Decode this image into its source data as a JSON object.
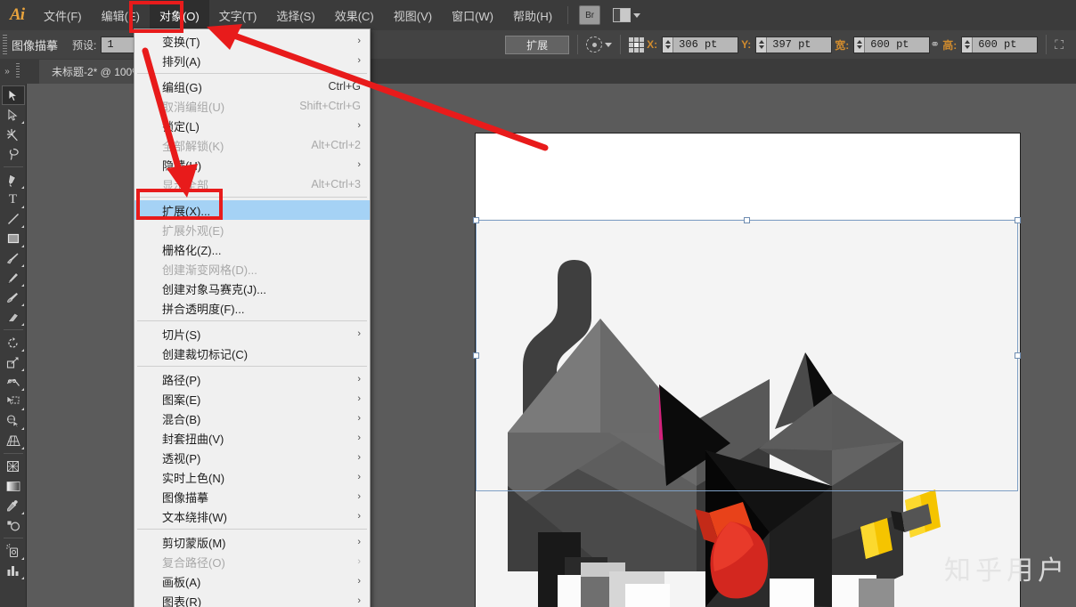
{
  "app": {
    "logo": "Ai",
    "title": "Adobe Illustrator"
  },
  "menubar": {
    "items": [
      {
        "label": "文件(F)",
        "active": false
      },
      {
        "label": "编辑(E)",
        "active": false
      },
      {
        "label": "对象(O)",
        "active": true
      },
      {
        "label": "文字(T)",
        "active": false
      },
      {
        "label": "选择(S)",
        "active": false
      },
      {
        "label": "效果(C)",
        "active": false
      },
      {
        "label": "视图(V)",
        "active": false
      },
      {
        "label": "窗口(W)",
        "active": false
      },
      {
        "label": "帮助(H)",
        "active": false
      }
    ],
    "bridge_button": "Br",
    "workspace_icon": "workspace-switcher-icon"
  },
  "controlbar": {
    "tool_label": "图像描摹",
    "preset_label": "预设:",
    "preset_value": "1",
    "expand_button": "扩展",
    "select_similar_icon": "select-similar-icon",
    "reference_point_icon": "reference-point-icon",
    "x_label": "X:",
    "x_value": "306 pt",
    "y_label": "Y:",
    "y_value": "397 pt",
    "w_label": "宽:",
    "w_value": "600 pt",
    "link_icon": "constrain-proportions-icon",
    "h_label": "高:",
    "h_value": "600 pt",
    "transform_icon": "transform-panel-icon"
  },
  "tabbar": {
    "document_tab": "未标题-2* @ 100%"
  },
  "toolbox": {
    "tools": [
      {
        "name": "selection-tool",
        "glyph": "selection",
        "selected": true,
        "flyout": false
      },
      {
        "name": "direct-selection-tool",
        "glyph": "direct",
        "selected": false,
        "flyout": true
      },
      {
        "name": "magic-wand-tool",
        "glyph": "wand",
        "selected": false,
        "flyout": false
      },
      {
        "name": "lasso-tool",
        "glyph": "lasso",
        "selected": false,
        "flyout": false
      },
      {
        "name": "pen-tool",
        "glyph": "pen",
        "selected": false,
        "flyout": true
      },
      {
        "name": "type-tool",
        "glyph": "type",
        "selected": false,
        "flyout": true
      },
      {
        "name": "line-segment-tool",
        "glyph": "line",
        "selected": false,
        "flyout": true
      },
      {
        "name": "rectangle-tool",
        "glyph": "rect",
        "selected": false,
        "flyout": true
      },
      {
        "name": "paintbrush-tool",
        "glyph": "brush",
        "selected": false,
        "flyout": true
      },
      {
        "name": "pencil-tool",
        "glyph": "pencil",
        "selected": false,
        "flyout": true
      },
      {
        "name": "blob-brush-tool",
        "glyph": "blob",
        "selected": false,
        "flyout": false
      },
      {
        "name": "eraser-tool",
        "glyph": "eraser",
        "selected": false,
        "flyout": true
      },
      {
        "name": "rotate-tool",
        "glyph": "rotate",
        "selected": false,
        "flyout": true
      },
      {
        "name": "scale-tool",
        "glyph": "scale",
        "selected": false,
        "flyout": true
      },
      {
        "name": "width-tool",
        "glyph": "width",
        "selected": false,
        "flyout": true
      },
      {
        "name": "free-transform-tool",
        "glyph": "freetransform",
        "selected": false,
        "flyout": false
      },
      {
        "name": "shape-builder-tool",
        "glyph": "shapebuilder",
        "selected": false,
        "flyout": true
      },
      {
        "name": "perspective-grid-tool",
        "glyph": "perspective",
        "selected": false,
        "flyout": true
      },
      {
        "name": "mesh-tool",
        "glyph": "mesh",
        "selected": false,
        "flyout": false
      },
      {
        "name": "gradient-tool",
        "glyph": "gradient",
        "selected": false,
        "flyout": false
      },
      {
        "name": "eyedropper-tool",
        "glyph": "eyedropper",
        "selected": false,
        "flyout": true
      },
      {
        "name": "blend-tool",
        "glyph": "blend",
        "selected": false,
        "flyout": false
      },
      {
        "name": "symbol-sprayer-tool",
        "glyph": "symbol",
        "selected": false,
        "flyout": true
      },
      {
        "name": "column-graph-tool",
        "glyph": "graph",
        "selected": false,
        "flyout": true
      }
    ]
  },
  "object_menu": {
    "items": [
      {
        "label": "变换(T)",
        "shortcut": "",
        "submenu": true,
        "disabled": false,
        "highlight": false,
        "separator_after": false
      },
      {
        "label": "排列(A)",
        "shortcut": "",
        "submenu": true,
        "disabled": false,
        "highlight": false,
        "separator_after": true
      },
      {
        "label": "编组(G)",
        "shortcut": "Ctrl+G",
        "submenu": false,
        "disabled": false,
        "highlight": false,
        "separator_after": false
      },
      {
        "label": "取消编组(U)",
        "shortcut": "Shift+Ctrl+G",
        "submenu": false,
        "disabled": true,
        "highlight": false,
        "separator_after": false
      },
      {
        "label": "锁定(L)",
        "shortcut": "",
        "submenu": true,
        "disabled": false,
        "highlight": false,
        "separator_after": false
      },
      {
        "label": "全部解锁(K)",
        "shortcut": "Alt+Ctrl+2",
        "submenu": false,
        "disabled": true,
        "highlight": false,
        "separator_after": false
      },
      {
        "label": "隐藏(H)",
        "shortcut": "",
        "submenu": true,
        "disabled": false,
        "highlight": false,
        "separator_after": false
      },
      {
        "label": "显示全部",
        "shortcut": "Alt+Ctrl+3",
        "submenu": false,
        "disabled": true,
        "highlight": false,
        "separator_after": true
      },
      {
        "label": "扩展(X)...",
        "shortcut": "",
        "submenu": false,
        "disabled": false,
        "highlight": true,
        "separator_after": false
      },
      {
        "label": "扩展外观(E)",
        "shortcut": "",
        "submenu": false,
        "disabled": true,
        "highlight": false,
        "separator_after": false
      },
      {
        "label": "栅格化(Z)...",
        "shortcut": "",
        "submenu": false,
        "disabled": false,
        "highlight": false,
        "separator_after": false
      },
      {
        "label": "创建渐变网格(D)...",
        "shortcut": "",
        "submenu": false,
        "disabled": true,
        "highlight": false,
        "separator_after": false
      },
      {
        "label": "创建对象马赛克(J)...",
        "shortcut": "",
        "submenu": false,
        "disabled": false,
        "highlight": false,
        "separator_after": false
      },
      {
        "label": "拼合透明度(F)...",
        "shortcut": "",
        "submenu": false,
        "disabled": false,
        "highlight": false,
        "separator_after": true
      },
      {
        "label": "切片(S)",
        "shortcut": "",
        "submenu": true,
        "disabled": false,
        "highlight": false,
        "separator_after": false
      },
      {
        "label": "创建裁切标记(C)",
        "shortcut": "",
        "submenu": false,
        "disabled": false,
        "highlight": false,
        "separator_after": true
      },
      {
        "label": "路径(P)",
        "shortcut": "",
        "submenu": true,
        "disabled": false,
        "highlight": false,
        "separator_after": false
      },
      {
        "label": "图案(E)",
        "shortcut": "",
        "submenu": true,
        "disabled": false,
        "highlight": false,
        "separator_after": false
      },
      {
        "label": "混合(B)",
        "shortcut": "",
        "submenu": true,
        "disabled": false,
        "highlight": false,
        "separator_after": false
      },
      {
        "label": "封套扭曲(V)",
        "shortcut": "",
        "submenu": true,
        "disabled": false,
        "highlight": false,
        "separator_after": false
      },
      {
        "label": "透视(P)",
        "shortcut": "",
        "submenu": true,
        "disabled": false,
        "highlight": false,
        "separator_after": false
      },
      {
        "label": "实时上色(N)",
        "shortcut": "",
        "submenu": true,
        "disabled": false,
        "highlight": false,
        "separator_after": false
      },
      {
        "label": "图像描摹",
        "shortcut": "",
        "submenu": true,
        "disabled": false,
        "highlight": false,
        "separator_after": false
      },
      {
        "label": "文本绕排(W)",
        "shortcut": "",
        "submenu": true,
        "disabled": false,
        "highlight": false,
        "separator_after": true
      },
      {
        "label": "剪切蒙版(M)",
        "shortcut": "",
        "submenu": true,
        "disabled": false,
        "highlight": false,
        "separator_after": false
      },
      {
        "label": "复合路径(O)",
        "shortcut": "",
        "submenu": true,
        "disabled": true,
        "highlight": false,
        "separator_after": false
      },
      {
        "label": "画板(A)",
        "shortcut": "",
        "submenu": true,
        "disabled": false,
        "highlight": false,
        "separator_after": false
      },
      {
        "label": "图表(R)",
        "shortcut": "",
        "submenu": true,
        "disabled": false,
        "highlight": false,
        "separator_after": false
      }
    ]
  },
  "canvas": {
    "artwork_name": "low-poly-cat-illustration",
    "watermark": "知乎用户"
  },
  "annotations": {
    "color": "#e81b1b",
    "highlight_menu_object": "对象(O)",
    "highlight_menu_expand": "扩展(X)..."
  }
}
